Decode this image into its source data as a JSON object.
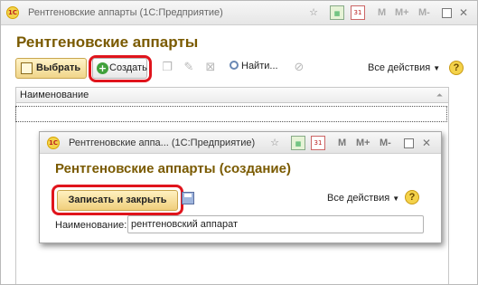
{
  "outer_window": {
    "title": "Рентгеновские аппарты  (1С:Предприятие)",
    "logo_text": "1С",
    "m_buttons": [
      "M",
      "M+",
      "M-"
    ],
    "form_title": "Рентгеновские аппарты",
    "toolbar": {
      "select_label": "Выбрать",
      "create_label": "Создать",
      "find_label": "Найти...",
      "all_actions_label": "Все действия"
    },
    "help_label": "?",
    "list": {
      "columns": [
        "Наименование"
      ]
    }
  },
  "inner_window": {
    "title": "Рентгеновские аппа...  (1С:Предприятие)",
    "logo_text": "1С",
    "m_buttons": [
      "M",
      "M+",
      "M-"
    ],
    "form_title": "Рентгеновские аппарты (создание)",
    "save_close_label": "Записать и закрыть",
    "all_actions_label": "Все действия",
    "help_label": "?",
    "name_label": "Наименование:",
    "name_value": "рентгеновский аппарат"
  },
  "icons": {
    "calendar_number": "31"
  },
  "colors": {
    "highlight": "#e0141c",
    "title_text": "#7a5a00",
    "accent_button": "#f0d58a"
  }
}
